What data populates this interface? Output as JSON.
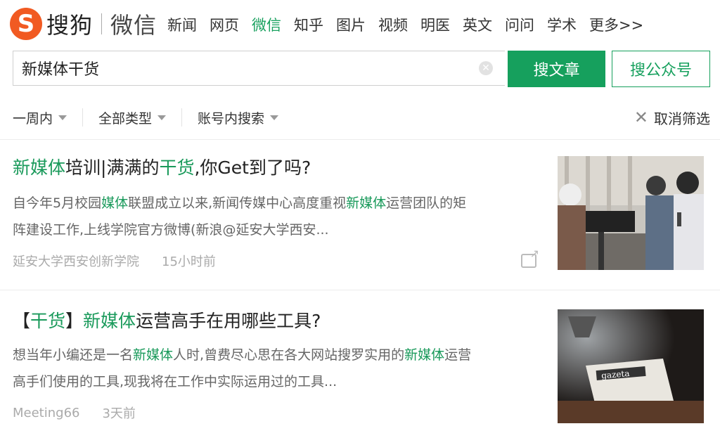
{
  "logo": {
    "mark": "S",
    "brand": "搜狗",
    "product": "微信"
  },
  "nav": [
    {
      "label": "新闻",
      "active": false
    },
    {
      "label": "网页",
      "active": false
    },
    {
      "label": "微信",
      "active": true
    },
    {
      "label": "知乎",
      "active": false
    },
    {
      "label": "图片",
      "active": false
    },
    {
      "label": "视频",
      "active": false
    },
    {
      "label": "明医",
      "active": false
    },
    {
      "label": "英文",
      "active": false
    },
    {
      "label": "问问",
      "active": false
    },
    {
      "label": "学术",
      "active": false
    },
    {
      "label": "更多>>",
      "active": false
    }
  ],
  "search": {
    "value": "新媒体干货",
    "article_button": "搜文章",
    "account_button": "搜公众号"
  },
  "filters": {
    "time": "一周内",
    "type": "全部类型",
    "account": "账号内搜索",
    "clear": "取消筛选"
  },
  "results": [
    {
      "title": {
        "parts": [
          {
            "text": "新媒体",
            "hl": true
          },
          {
            "text": "培训|满满的",
            "hl": false
          },
          {
            "text": "干货",
            "hl": true
          },
          {
            "text": ",你Get到了吗?",
            "hl": false
          }
        ]
      },
      "snippet_line1": {
        "parts": [
          {
            "text": "自今年5月校园",
            "hl": false
          },
          {
            "text": "媒体",
            "hl": true
          },
          {
            "text": "联盟成立以来,新闻传媒中心高度重视",
            "hl": false
          },
          {
            "text": "新媒体",
            "hl": true
          },
          {
            "text": "运营团队的矩",
            "hl": false
          }
        ]
      },
      "snippet_line2": "阵建设工作,上线学院官方微博(新浪@延安大学西安...",
      "source": "延安大学西安创新学院",
      "time": "15小时前",
      "thumb_icon": "camera-crew-photo"
    },
    {
      "title": {
        "parts": [
          {
            "text": "【",
            "hl": false
          },
          {
            "text": "干货",
            "hl": true
          },
          {
            "text": "】",
            "hl": false
          },
          {
            "text": "新媒体",
            "hl": true
          },
          {
            "text": "运营高手在用哪些工具?",
            "hl": false
          }
        ]
      },
      "snippet_line1": {
        "parts": [
          {
            "text": "想当年小编还是一名",
            "hl": false
          },
          {
            "text": "新媒体",
            "hl": true
          },
          {
            "text": "人时,曾费尽心思在各大网站搜罗实用的",
            "hl": false
          },
          {
            "text": "新媒体",
            "hl": true
          },
          {
            "text": "运营",
            "hl": false
          }
        ]
      },
      "snippet_line2": "高手们使用的工具,现我将在工作中实际运用过的工具...",
      "source": "Meeting66",
      "time": "3天前",
      "thumb_icon": "newspaper-laptop-photo",
      "thumb_text": "gazeta"
    }
  ],
  "colors": {
    "accent": "#16a05d",
    "highlight": "#1a9a5b",
    "logo": "#f15a22"
  }
}
